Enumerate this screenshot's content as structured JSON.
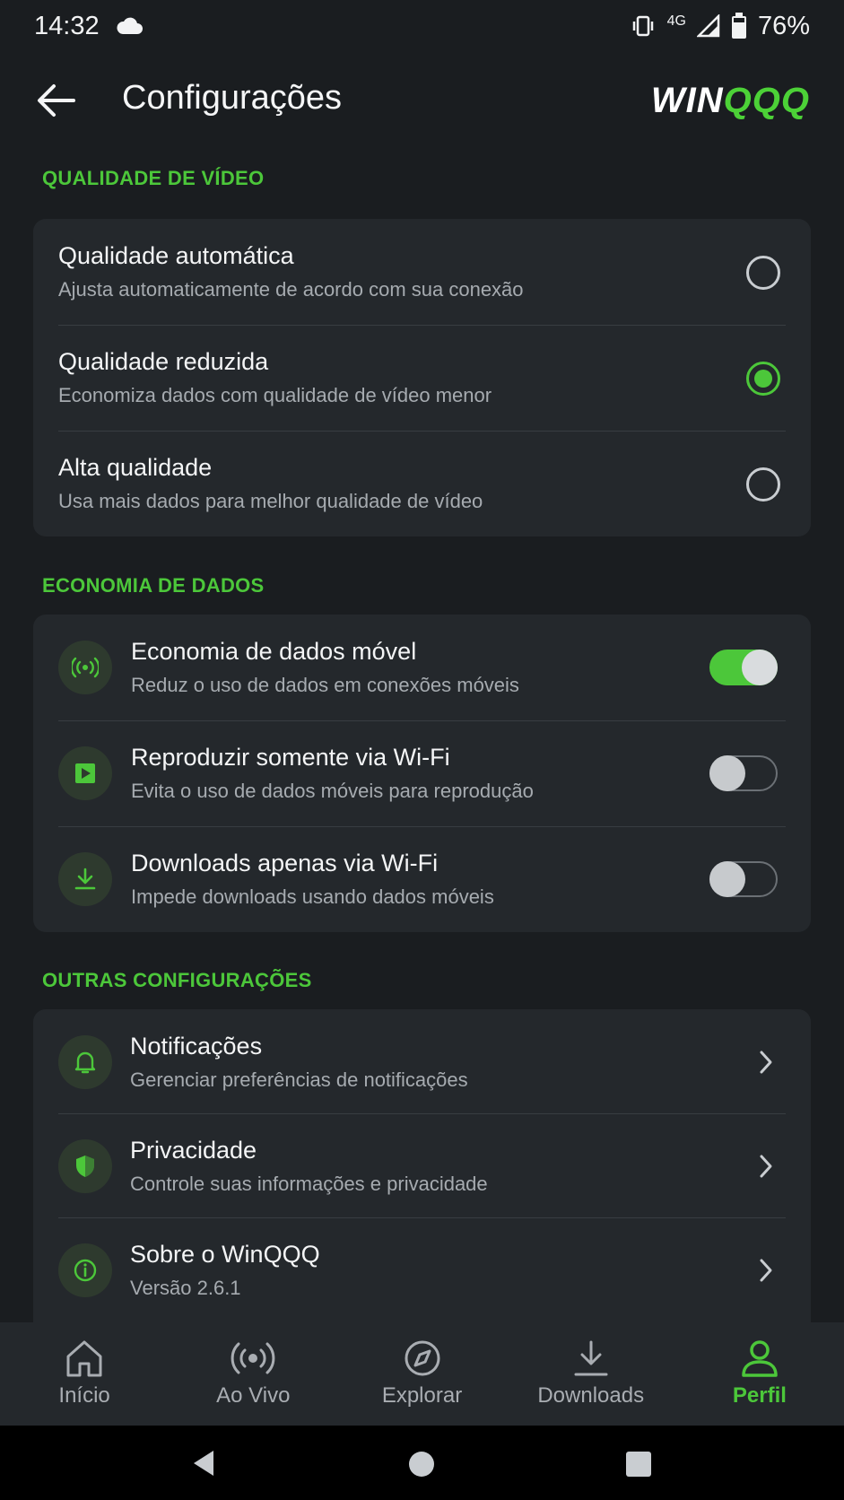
{
  "status_bar": {
    "time": "14:32",
    "network": "4G",
    "battery": "76%",
    "icons": [
      "cloud-icon",
      "vibrate-icon",
      "signal-icon",
      "battery-icon"
    ]
  },
  "app_bar": {
    "title": "Configurações",
    "brand_a": "WIN",
    "brand_b": "QQQ"
  },
  "video_quality": {
    "label": "QUALIDADE DE VÍDEO",
    "options": [
      {
        "title": "Qualidade automática",
        "subtitle": "Ajusta automaticamente de acordo com sua conexão",
        "selected": false
      },
      {
        "title": "Qualidade reduzida",
        "subtitle": "Economiza dados com qualidade de vídeo menor",
        "selected": true
      },
      {
        "title": "Alta qualidade",
        "subtitle": "Usa mais dados para melhor qualidade de vídeo",
        "selected": false
      }
    ]
  },
  "data_saving": {
    "label": "ECONOMIA DE DADOS",
    "items": [
      {
        "title": "Economia de dados móvel",
        "subtitle": "Reduz o uso de dados em conexões móveis",
        "icon": "signal-broadcast-icon",
        "on": true
      },
      {
        "title": "Reproduzir somente via Wi-Fi",
        "subtitle": "Evita o uso de dados móveis para reprodução",
        "icon": "play-icon",
        "on": false
      },
      {
        "title": "Downloads apenas via Wi-Fi",
        "subtitle": "Impede downloads usando dados móveis",
        "icon": "download-icon",
        "on": false
      }
    ]
  },
  "other_settings": {
    "label": "OUTRAS CONFIGURAÇÕES",
    "items": [
      {
        "title": "Notificações",
        "subtitle": "Gerenciar preferências de notificações",
        "icon": "bell-icon"
      },
      {
        "title": "Privacidade",
        "subtitle": "Controle suas informações e privacidade",
        "icon": "shield-icon"
      },
      {
        "title": "Sobre o WinQQQ",
        "subtitle": "Versão 2.6.1",
        "icon": "info-icon"
      }
    ]
  },
  "bottom_nav": {
    "items": [
      {
        "label": "Início",
        "icon": "home-icon",
        "active": false
      },
      {
        "label": "Ao Vivo",
        "icon": "live-icon",
        "active": false
      },
      {
        "label": "Explorar",
        "icon": "compass-icon",
        "active": false
      },
      {
        "label": "Downloads",
        "icon": "download-icon",
        "active": false
      },
      {
        "label": "Perfil",
        "icon": "profile-icon",
        "active": true
      }
    ]
  },
  "colors": {
    "background": "#1a1d20",
    "card": "#24282c",
    "accent": "#4cc73a",
    "text_primary": "#f4f5f6",
    "text_secondary": "#a6abb0"
  }
}
